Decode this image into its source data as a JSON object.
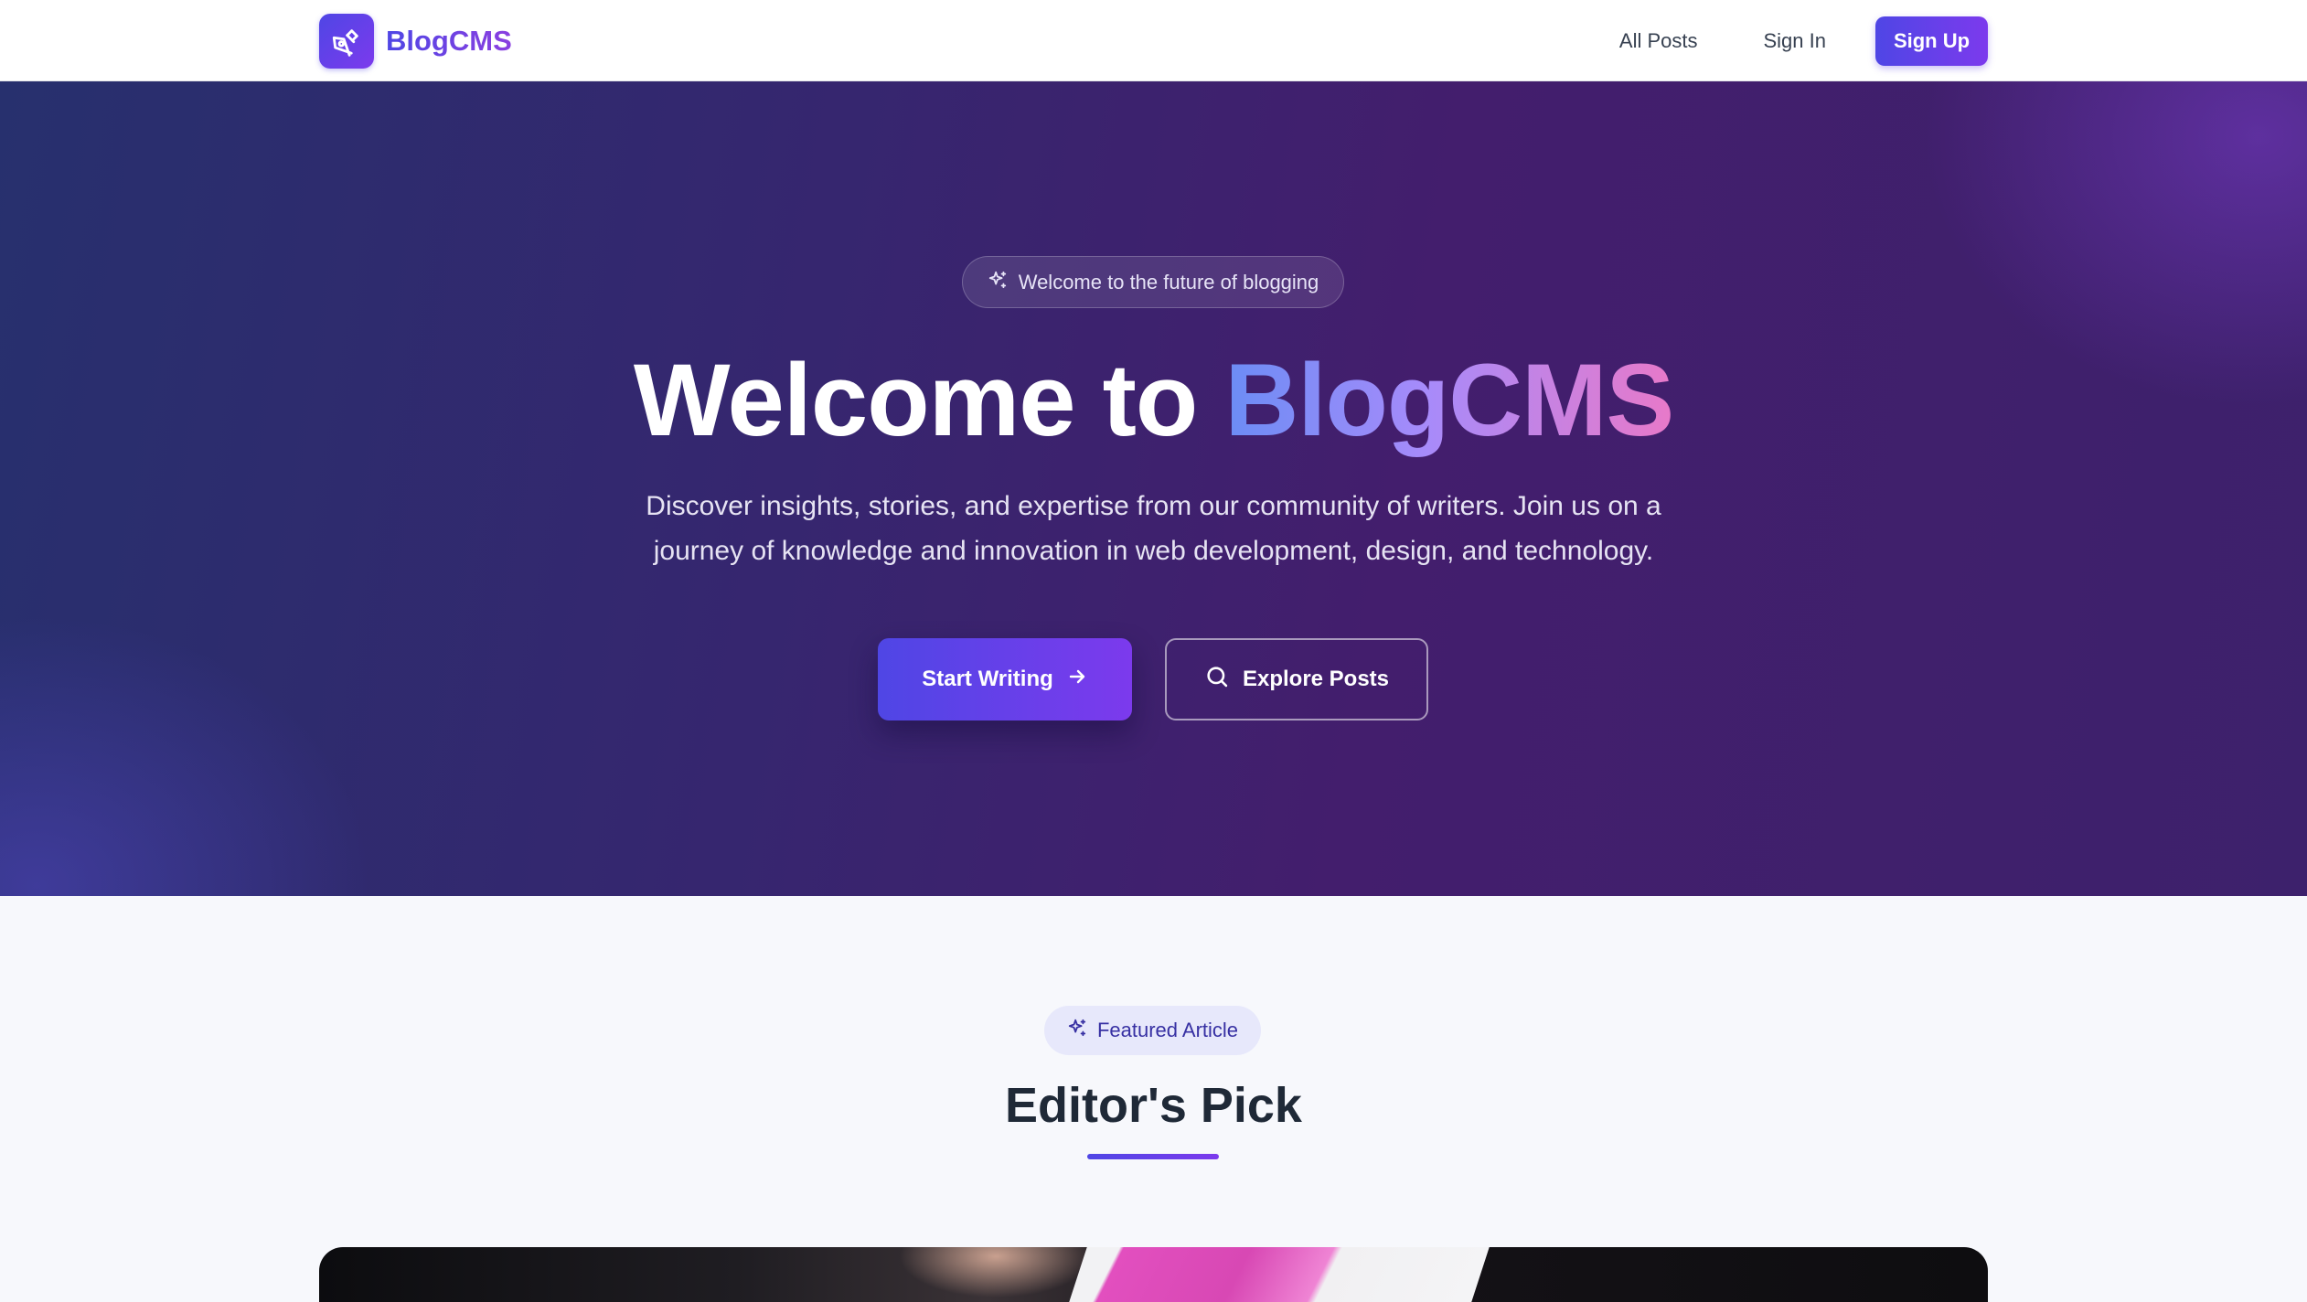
{
  "brand": {
    "name": "BlogCMS",
    "logo_icon": "pen-nib-icon"
  },
  "nav": {
    "all_posts": "All Posts",
    "sign_in": "Sign In",
    "sign_up": "Sign Up"
  },
  "hero": {
    "badge_icon": "sparkles-icon",
    "badge_text": "Welcome to the future of blogging",
    "title_prefix": "Welcome to ",
    "title_accent": "BlogCMS",
    "subtitle": "Discover insights, stories, and expertise from our community of writers. Join us on a journey of knowledge and innovation in web development, design, and technology.",
    "primary_button": "Start Writing",
    "primary_button_icon": "arrow-right-icon",
    "secondary_button": "Explore Posts",
    "secondary_button_icon": "search-icon"
  },
  "featured": {
    "badge_icon": "sparkles-icon",
    "badge_text": "Featured Article",
    "title": "Editor's Pick"
  },
  "colors": {
    "brand_primary": "#4f46e5",
    "brand_secondary": "#7c3aed",
    "hero_bg": "#36266f",
    "accent_pink": "#e879c9"
  }
}
